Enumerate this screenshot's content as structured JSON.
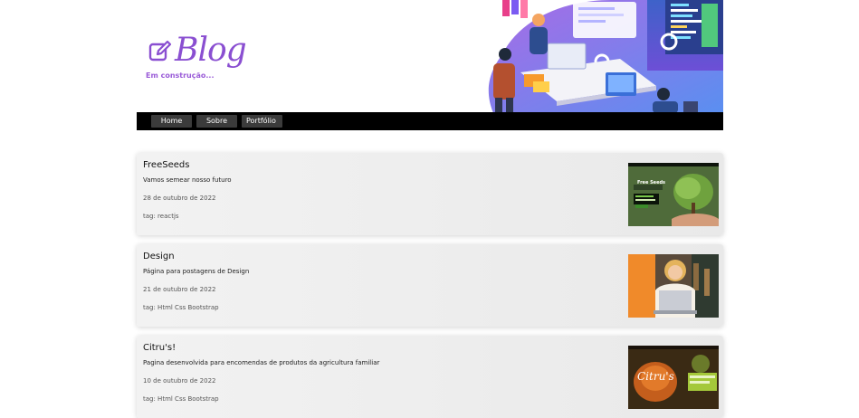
{
  "header": {
    "logo_text": "Blog",
    "subtitle": "Em construção..."
  },
  "nav": {
    "items": [
      {
        "label": "Home"
      },
      {
        "label": "Sobre"
      },
      {
        "label": "Portfólio"
      }
    ]
  },
  "posts": [
    {
      "title": "FreeSeeds",
      "description": "Vamos semear nosso futuro",
      "date": "28 de outubro de 2022",
      "tag": "tag: reactjs",
      "thumb_title": "Free Seeds"
    },
    {
      "title": "Design",
      "description": "Página para postagens de Design",
      "date": "21 de outubro de 2022",
      "tag": "tag: Html Css Bootstrap"
    },
    {
      "title": "Citru's!",
      "description": "Pagina desenvolvida para encomendas de produtos da agricultura familiar",
      "date": "10 de outubro de 2022",
      "tag": "tag: Html Css Bootstrap",
      "thumb_title": "Citru's"
    }
  ],
  "colors": {
    "brand": "#8a4fd1",
    "nav_bg": "#000000",
    "nav_button": "#3b3b3b"
  }
}
